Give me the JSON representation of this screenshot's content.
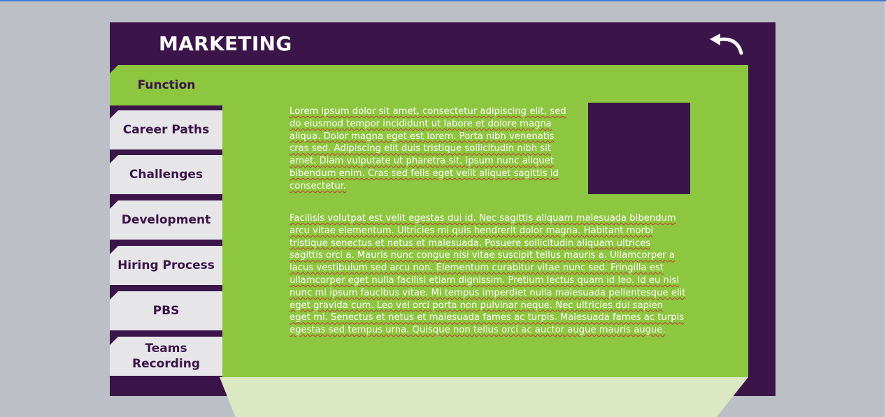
{
  "header": {
    "title": "MARKETING",
    "back_icon": "back-arrow-icon"
  },
  "tabs": {
    "active": "Function",
    "items": [
      "Career Paths",
      "Challenges",
      "Development",
      "Hiring Process",
      "PBS",
      "Teams Recording"
    ]
  },
  "content": {
    "paragraph1": "Lorem ipsum dolor sit amet, consectetur adipiscing elit, sed do eiusmod tempor incididunt ut labore et dolore magna aliqua. Dolor magna eget est lorem. Porta nibh venenatis cras sed. Adipiscing elit duis tristique sollicitudin nibh sit amet. Diam vulputate ut pharetra sit. Ipsum nunc aliquet bibendum enim. Cras sed felis eget velit aliquet sagittis id consectetur.",
    "paragraph2": "Facilisis volutpat est velit egestas dui id. Nec sagittis aliquam malesuada bibendum arcu vitae elementum. Ultricies mi quis hendrerit dolor magna. Habitant morbi tristique senectus et netus et malesuada. Posuere sollicitudin aliquam ultrices sagittis orci a. Mauris nunc congue nisi vitae suscipit tellus mauris a. Ullamcorper a lacus vestibulum sed arcu non. Elementum curabitur vitae nunc sed. Fringilla est ullamcorper eget nulla facilisi etiam dignissim. Pretium lectus quam id leo. Id eu nisl nunc mi ipsum faucibus vitae. Mi tempus imperdiet nulla malesuada pellentesque elit eget gravida cum. Leo vel orci porta non pulvinar neque. Nec ultricies dui sapien eget mi. Senectus et netus et malesuada fames ac turpis. Malesuada fames ac turpis egestas sed tempus urna. Quisque non tellus orci ac auctor augue mauris augue."
  },
  "colors": {
    "brand_purple": "#3b1449",
    "brand_green": "#8dc63f",
    "tab_gray": "#e6e6e8"
  }
}
